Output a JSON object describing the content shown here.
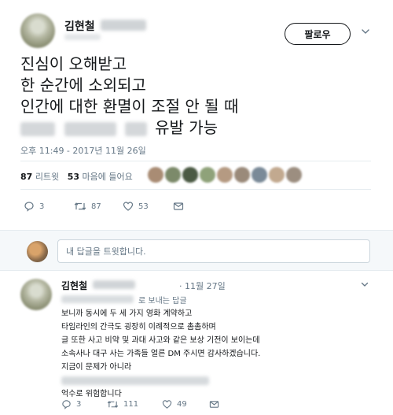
{
  "tweet": {
    "author_name": "김현철",
    "follow_label": "팔로우",
    "text_lines": [
      "진심이 오해받고",
      "한 순간에 소외되고",
      "인간에 대한 환멸이 조절 안 될 때"
    ],
    "text_last_line_visible": "유발 가능",
    "timestamp": "오후 11:49 - 2017년 11월 26일",
    "retweet_count": "87",
    "retweet_label": "리트윗",
    "like_count": "53",
    "like_label": "마음에 들어요",
    "actions": {
      "reply_count": "3",
      "retweet_count": "87",
      "like_count": "53"
    }
  },
  "reply_box": {
    "placeholder": "내 답글을 트윗합니다."
  },
  "reply": {
    "author_name": "김현철",
    "date": "11월 27일",
    "reply_to_suffix": "로 보내는 답글",
    "lines": [
      "보니까 동시에 두 세 가지 영화 계약하고",
      "타임라인의 간극도 굉장히 이례적으로 촘촘하며",
      "글 또한 사고 비약 및 과대 사고와 같은 보상 기전이 보이는데",
      "소속사나 대구 사는 가족들 얼른 DM 주시면 감사하겠습니다.",
      "지금이 문제가 아니라"
    ],
    "last_line": "억수로 위험합니다",
    "actions": {
      "reply_count": "3",
      "retweet_count": "111",
      "like_count": "49"
    }
  },
  "colors": {
    "text": "#14171a",
    "muted": "#657786",
    "border": "#e6ecf0",
    "bar_bg": "#f5f8fa"
  },
  "icons": [
    "caret-down-icon",
    "reply-icon",
    "retweet-icon",
    "heart-icon",
    "message-icon"
  ]
}
